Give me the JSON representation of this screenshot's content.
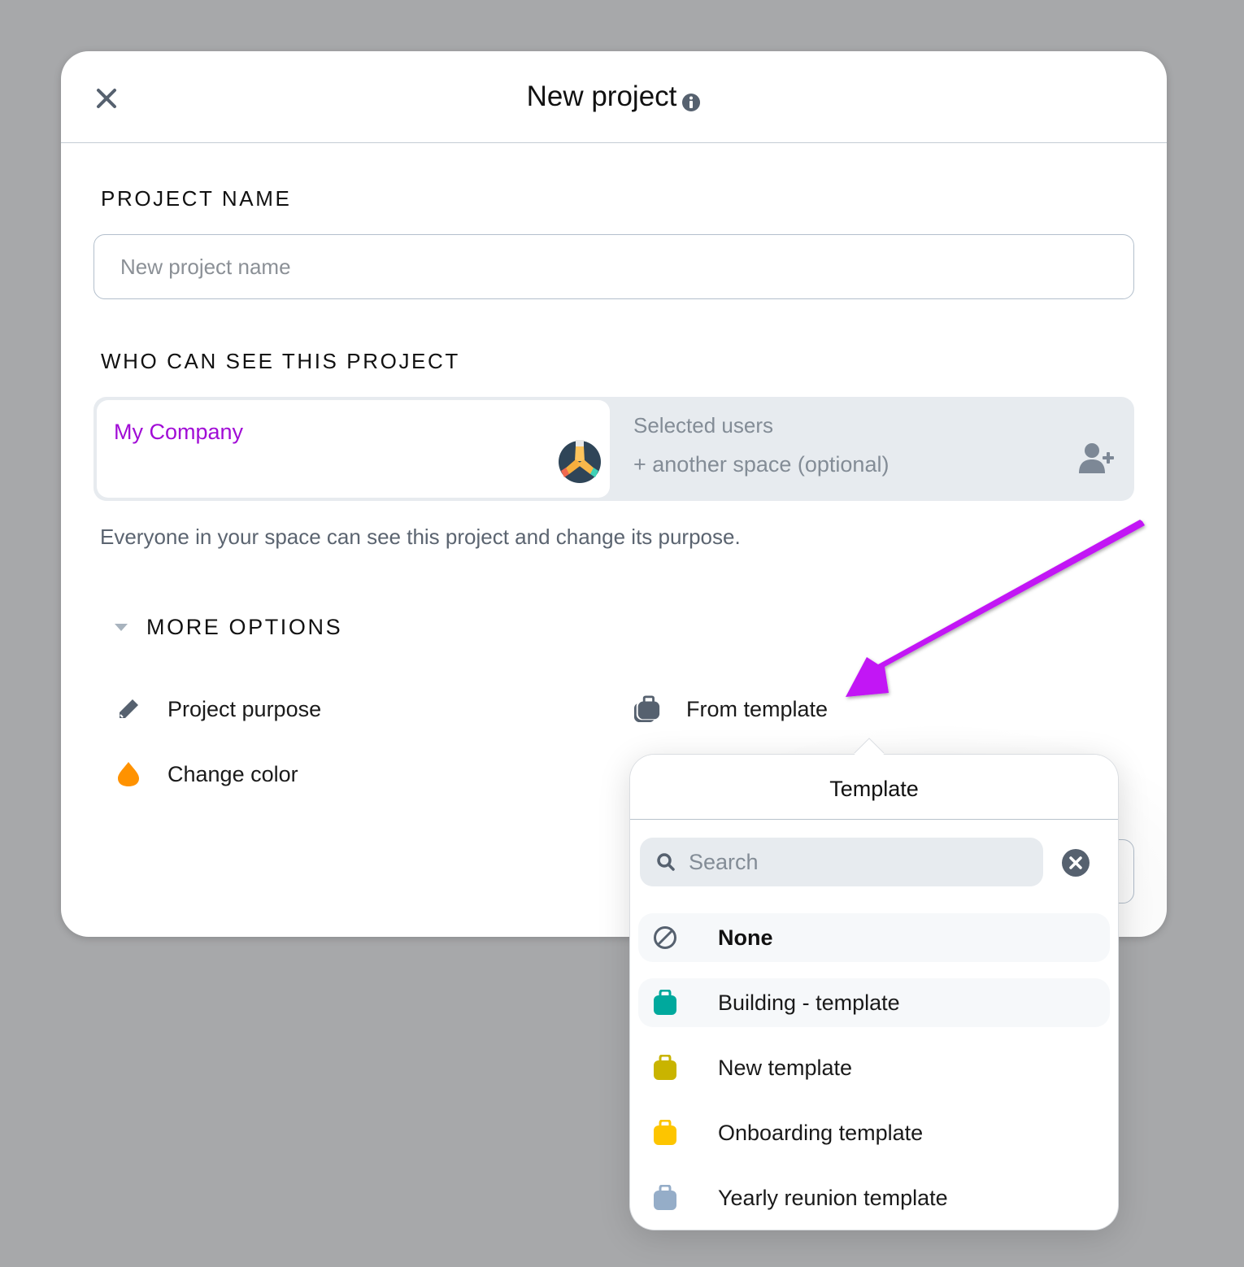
{
  "modal": {
    "title": "New project",
    "close_label": "Close",
    "project_name": {
      "label": "PROJECT NAME",
      "value": "",
      "placeholder": "New project name"
    },
    "visibility": {
      "label": "WHO CAN SEE THIS PROJECT",
      "company_option": "My Company",
      "users_option_line1": "Selected users",
      "users_option_line2": "+ another space (optional)",
      "help_text": "Everyone in your space can see this project and change its purpose."
    },
    "more_options": {
      "label": "MORE OPTIONS",
      "items": [
        {
          "label": "Project purpose",
          "icon": "pencil-icon"
        },
        {
          "label": "Change color",
          "icon": "droplet-icon",
          "color": "#ff9200"
        },
        {
          "label": "From template",
          "icon": "briefcase-stack-icon"
        }
      ]
    }
  },
  "template_popover": {
    "title": "Template",
    "search": {
      "value": "",
      "placeholder": "Search"
    },
    "items": [
      {
        "label": "None",
        "icon": "ban-icon",
        "selected": true
      },
      {
        "label": "Building - template",
        "icon": "briefcase-icon",
        "color": "#00a99d"
      },
      {
        "label": "New template",
        "icon": "briefcase-icon",
        "color": "#c9b400"
      },
      {
        "label": "Onboarding template",
        "icon": "briefcase-icon",
        "color": "#fdc500"
      },
      {
        "label": "Yearly reunion template",
        "icon": "briefcase-icon",
        "color": "#95adc8"
      }
    ]
  },
  "colors": {
    "accent_company": "#a10cd6",
    "annotation_arrow": "#c214f5",
    "icon_gray": "#56616f"
  }
}
